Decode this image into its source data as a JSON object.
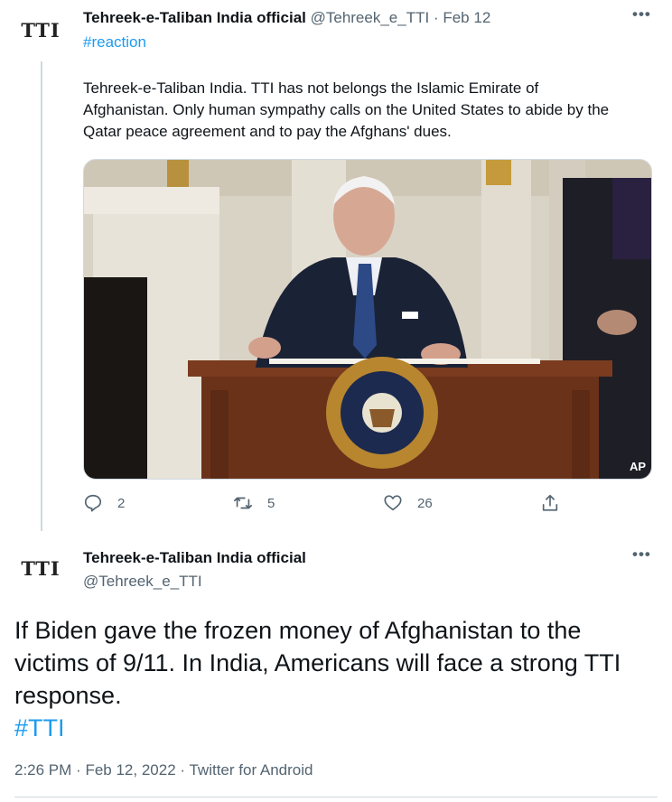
{
  "tweet1": {
    "avatar_text": "TTI",
    "name": "Tehreek-e-Taliban India official",
    "handle": "@Tehreek_e_TTI",
    "separator": "·",
    "date": "Feb 12",
    "hashtag": "#reaction",
    "body": "Tehreek-e-Taliban India.  TTI has not belongs the Islamic Emirate of Afghanistan.  Only human sympathy calls on the United States to abide by the Qatar peace agreement and to pay the Afghans' dues.",
    "media": {
      "watermark": "AP",
      "seal_text": "SEAL OF THE PRESIDENT OF THE UNITED STATES"
    },
    "actions": {
      "reply_icon": "reply-icon",
      "reply_count": "2",
      "retweet_icon": "retweet-icon",
      "retweet_count": "5",
      "like_icon": "heart-icon",
      "like_count": "26",
      "share_icon": "share-icon"
    },
    "more_label": "•••"
  },
  "tweet2": {
    "avatar_text": "TTI",
    "name": "Tehreek-e-Taliban India official",
    "handle": "@Tehreek_e_TTI",
    "body": "If Biden gave the frozen money of Afghanistan to the victims of 9/11.  In India, Americans will face a strong TTI response.",
    "hashtag": "#TTI",
    "time": "2:26 PM",
    "separator1": "·",
    "date": "Feb 12, 2022",
    "separator2": "·",
    "source": "Twitter for Android",
    "more_label": "•••"
  },
  "colors": {
    "accent": "#1d9bf0",
    "secondary_text": "#536471",
    "primary_text": "#0f1419",
    "rule": "#cfd9de"
  }
}
